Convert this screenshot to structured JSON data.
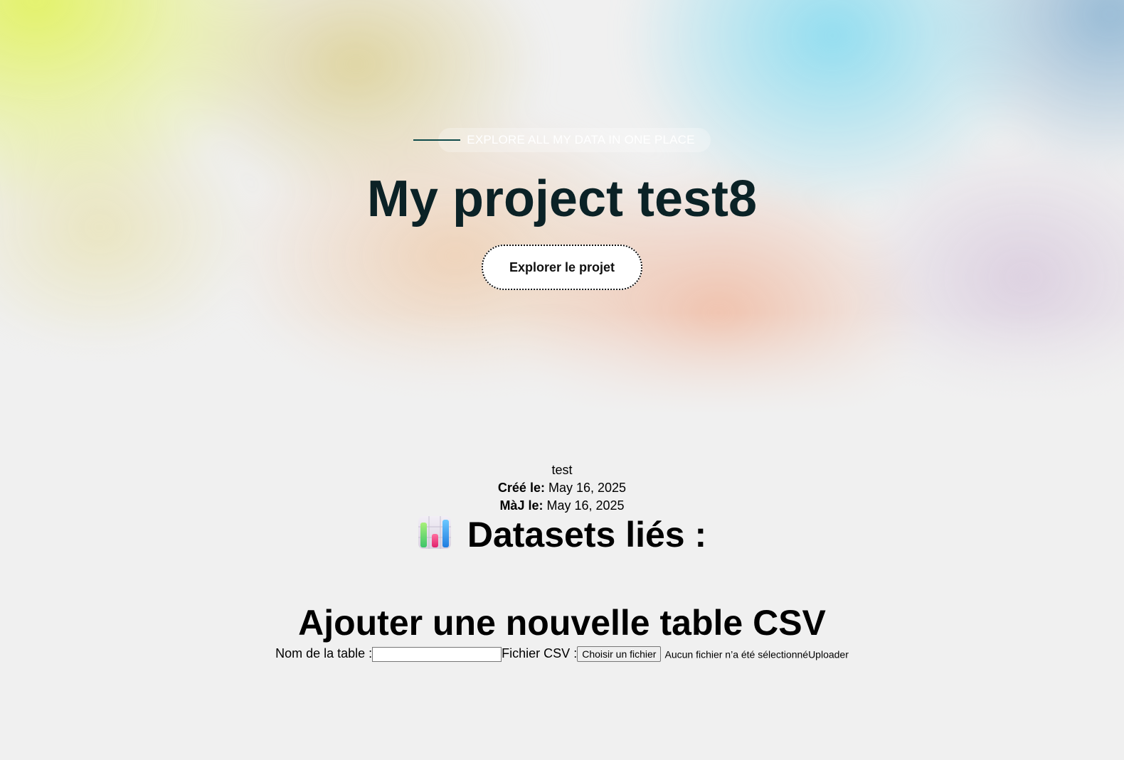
{
  "hero": {
    "tagline": "EXPLORE ALL MY DATA IN ONE PLACE",
    "title": "My project test8",
    "explore_button": "Explorer le projet"
  },
  "project": {
    "description": "test",
    "created_label": "Créé le:",
    "created_value": "May 16, 2025",
    "updated_label": "MàJ le:",
    "updated_value": "May 16, 2025"
  },
  "datasets": {
    "heading": "Datasets liés :",
    "icon": "bar-chart-icon"
  },
  "upload_form": {
    "heading": "Ajouter une nouvelle table CSV",
    "table_name_label": "Nom de la table :",
    "table_name_value": "",
    "csv_label": "Fichier CSV :",
    "choose_file_button": "Choisir un fichier",
    "no_file_text": "Aucun fichier n’a été sélectionné",
    "upload_button": "Uploader"
  },
  "colors": {
    "title": "#0b2226",
    "tagline_line": "#0e4a4a",
    "page_background": "#f0f0f0"
  }
}
